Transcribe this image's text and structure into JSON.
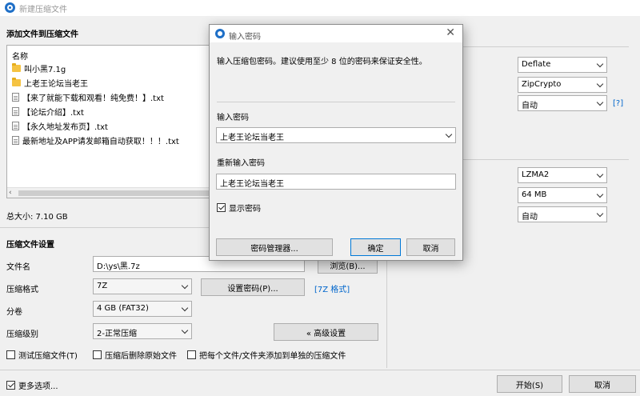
{
  "window": {
    "title": "新建压缩文件"
  },
  "files": {
    "heading": "添加文件到压缩文件",
    "column_name": "名称",
    "items": [
      {
        "name": "叫小黑7.1g",
        "type": "folder"
      },
      {
        "name": "上老王论坛当老王",
        "type": "folder"
      },
      {
        "name": "【来了就能下载和观看！纯免费！】.txt",
        "type": "file"
      },
      {
        "name": "【论坛介绍】.txt",
        "type": "file"
      },
      {
        "name": "【永久地址发布页】.txt",
        "type": "file"
      },
      {
        "name": "最新地址及APP请发邮箱自动获取！！！.txt",
        "type": "file"
      }
    ],
    "total_size": "总大小: 7.10 GB"
  },
  "settings": {
    "heading": "压缩文件设置",
    "filename_label": "文件名",
    "filename_value": "D:\\ys\\黑.7z",
    "browse_label": "浏览(B)...",
    "format_label": "压缩格式",
    "format_value": "7Z",
    "set_password_label": "设置密码(P)...",
    "format_link": "[7Z 格式]",
    "split_label": "分卷",
    "split_value": "4 GB (FAT32)",
    "level_label": "压缩级别",
    "level_value": "2-正常压缩",
    "advanced_label": "« 高级设置",
    "test_label": "测试压缩文件(T)",
    "delete_label": "压缩后删除原始文件",
    "separate_label": "把每个文件/文件夹添加到单独的压缩文件"
  },
  "right_panel": {
    "zip_method": "Deflate",
    "zip_encryption": "ZipCrypto",
    "zip_auto": "自动",
    "help_link": "[?]",
    "sevenz_method": "LZMA2",
    "sevenz_dict": "64 MB",
    "sevenz_auto": "自动"
  },
  "footer": {
    "more_options": "更多选项...",
    "start_label": "开始(S)",
    "cancel_label": "取消"
  },
  "dialog": {
    "title": "输入密码",
    "description": "输入压缩包密码。建议使用至少 8 位的密码来保证安全性。",
    "password_label": "输入密码",
    "password_value": "上老王论坛当老王",
    "confirm_label": "重新输入密码",
    "confirm_value": "上老王论坛当老王",
    "show_password_label": "显示密码",
    "manager_label": "密码管理器...",
    "ok_label": "确定",
    "cancel_label": "取消"
  }
}
